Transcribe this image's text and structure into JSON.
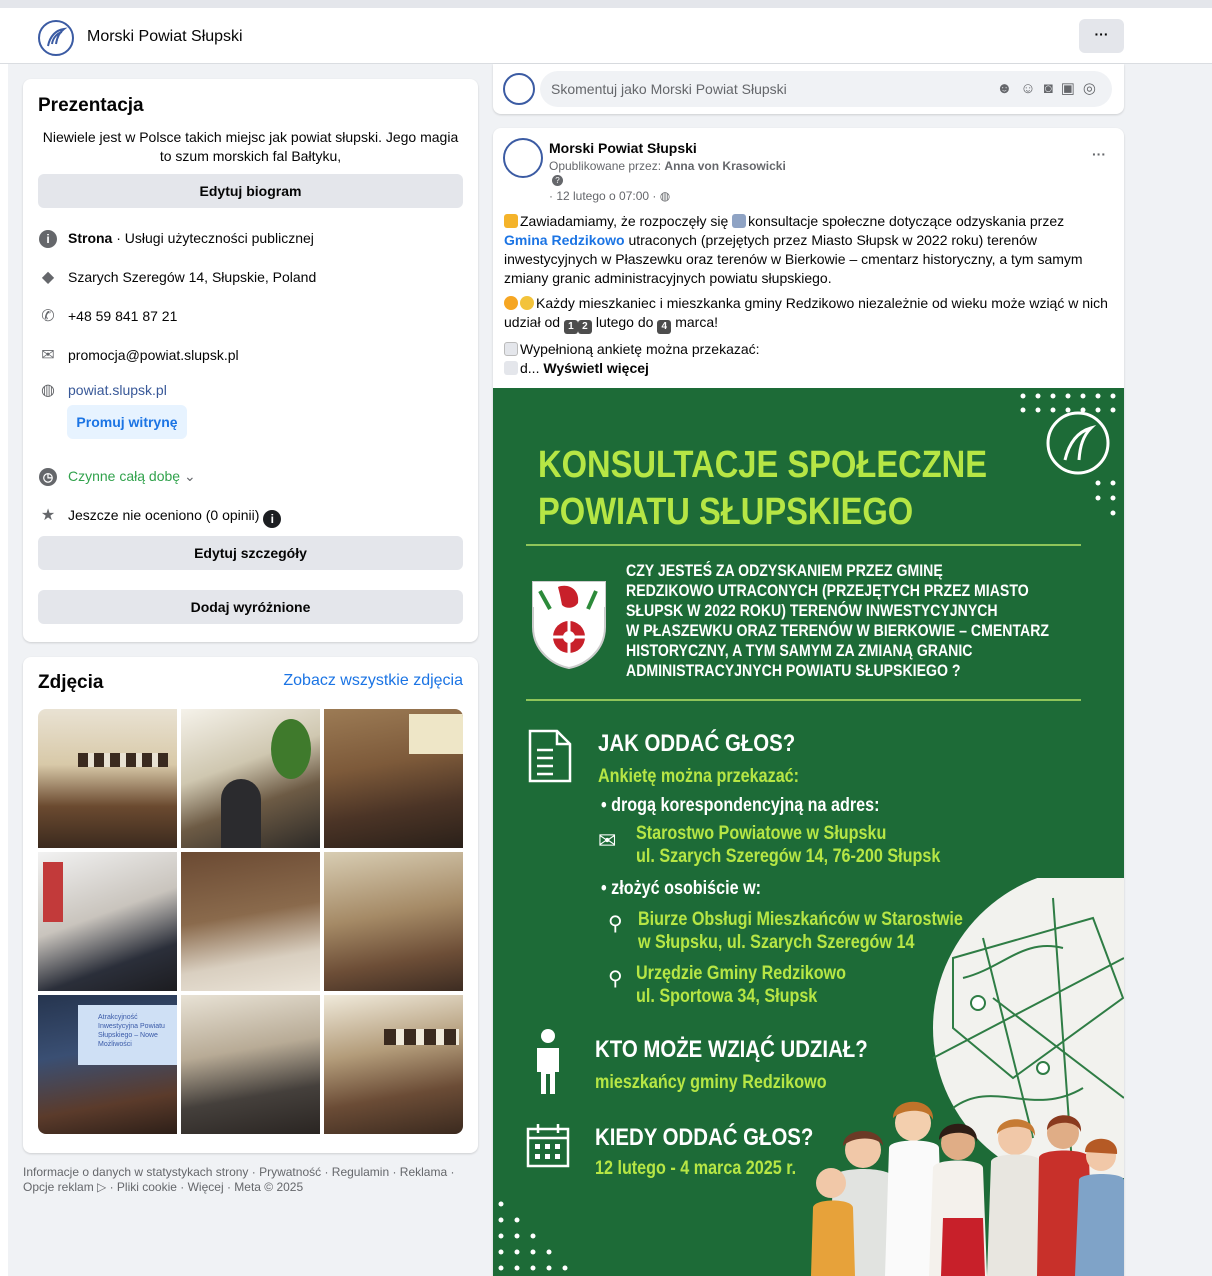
{
  "topbar": {
    "page_name": "Morski Powiat Słupski",
    "more_label": "···"
  },
  "about": {
    "title": "Prezentacja",
    "bio": "Niewiele jest w Polsce takich miejsc jak powiat słupski. Jego magia to szum morskich fal Bałtyku,",
    "edit_bio": "Edytuj biogram",
    "category_bold": "Strona",
    "category_rest": " · Usługi użyteczności publicznej",
    "address": "Szarych Szeregów 14, Słupskie, Poland",
    "phone": "+48 59 841 87 21",
    "email": "promocja@powiat.slupsk.pl",
    "website": "powiat.slupsk.pl",
    "promote": "Promuj witrynę",
    "hours": "Czynne całą dobę",
    "rating": "Jeszcze nie oceniono (0 opinii)",
    "edit_details": "Edytuj szczegóły",
    "add_featured": "Dodaj wyróżnione"
  },
  "photos": {
    "title": "Zdjęcia",
    "see_all": "Zobacz wszystkie zdjęcia",
    "slide_text": "Atrakcyjność Inwestycyjna Powiatu Słupskiego – Nowe Możliwości"
  },
  "footer": {
    "line1": "Informacje o danych w statystykach strony · Prywatność · Regulamin · Reklama ·",
    "line2": "Opcje reklam ▷ · Pliki cookie · Więcej · Meta © 2025"
  },
  "comment": {
    "placeholder": "Skomentuj jako Morski Powiat Słupski"
  },
  "post": {
    "author": "Morski Powiat Słupski",
    "published_by_prefix": "Opublikowane przez: ",
    "published_by": "Anna von Krasowicki",
    "date": "· 12 lutego o 07:00 ·",
    "more": "···",
    "p1_a": "Zawiadamiamy, że rozpoczęły się ",
    "p1_b": "konsultacje społeczne dotyczące odzyskania przez ",
    "p1_link": "Gmina Redzikowo",
    "p1_c": " utraconych (przejętych przez Miasto Słupsk w 2022 roku) terenów inwestycyjnych w Płaszewku oraz terenów w Bierkowie – cmentarz historyczny, a tym samym zmiany granic administracyjnych powiatu słupskiego.",
    "p2_a": "Każdy mieszkaniec i mieszkanka gminy Redzikowo niezależnie od wieku może wziąć w nich udział od ",
    "p2_n1": "1",
    "p2_n2": "2",
    "p2_b": " lutego do ",
    "p2_n3": "4",
    "p2_c": " marca!",
    "p3": "Wypełnioną ankietę można przekazać:",
    "p4_a": "d... ",
    "p4_more": "Wyświetl więcej"
  },
  "poster": {
    "title1": "KONSULTACJE SPOŁECZNE",
    "title2": "POWIATU SŁUPSKIEGO",
    "q1": "CZY JESTEŚ ZA ODZYSKANIEM PRZEZ GMINĘ",
    "q2": "REDZIKOWO UTRACONYCH (PRZEJĘTYCH PRZEZ MIASTO",
    "q3": "SŁUPSK W 2022 ROKU) TERENÓW INWESTYCYJNYCH",
    "q4": "W PŁASZEWKU ORAZ TERENÓW W BIERKOWIE – CMENTARZ",
    "q5": "HISTORYCZNY, A TYM SAMYM ZA ZMIANĄ GRANIC",
    "q6": "ADMINISTRACYJNYCH POWIATU SŁUPSKIEGO ?",
    "h_how": "JAK ODDAĆ GŁOS?",
    "how_sub": "Ankietę można przekazać:",
    "how_b1": "• drogą korespondencyjną na adres:",
    "addr1": "Starostwo Powiatowe w Słupsku",
    "addr2": "ul. Szarych Szeregów 14, 76-200 Słupsk",
    "how_b2": "• złożyć osobiście w:",
    "loc1a": "Biurze Obsługi Mieszkańców w Starostwie",
    "loc1b": "w Słupsku, ul. Szarych Szeregów 14",
    "loc2a": "Urzędzie Gminy Redzikowo",
    "loc2b": "ul. Sportowa 34, Słupsk",
    "h_who": "KTO MOŻE WZIĄĆ UDZIAŁ?",
    "who_sub": "mieszkańcy gminy Redzikowo",
    "h_when": "KIEDY ODDAĆ GŁOS?",
    "when_sub": "12 lutego - 4 marca 2025 r."
  },
  "colors": {
    "accent": "#1b74e4",
    "poster_bg": "#1d6b37",
    "poster_lime": "#b6e645",
    "hours_green": "#31a24c"
  }
}
